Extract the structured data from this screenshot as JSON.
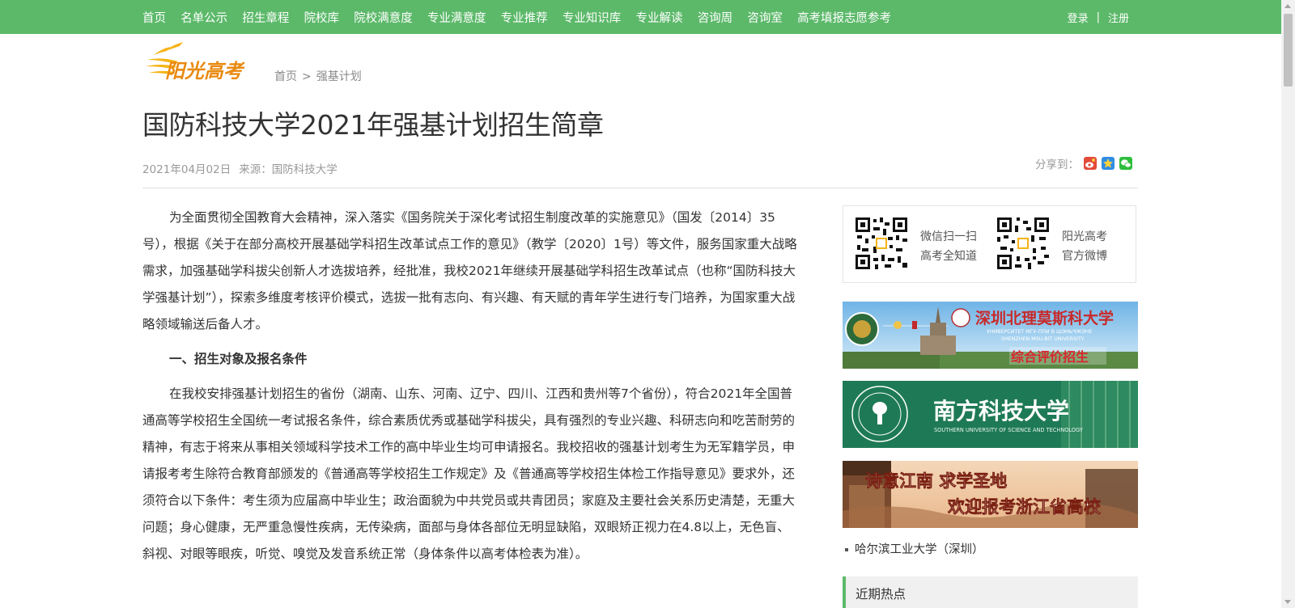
{
  "nav": {
    "items": [
      "首页",
      "名单公示",
      "招生章程",
      "院校库",
      "院校满意度",
      "专业满意度",
      "专业推荐",
      "专业知识库",
      "专业解读",
      "咨询周",
      "咨询室",
      "高考填报志愿参考"
    ],
    "login": "登录",
    "separator": "|",
    "register": "注册"
  },
  "logo": {
    "text": "阳光高考"
  },
  "breadcrumb": {
    "home": "首页",
    "sep": ">",
    "current": "强基计划"
  },
  "article": {
    "title": "国防科技大学2021年强基计划招生简章",
    "date": "2021年04月02日",
    "source": "来源：国防科技大学",
    "share_label": "分享到：",
    "paragraphs": [
      "为全面贯彻全国教育大会精神，深入落实《国务院关于深化考试招生制度改革的实施意见》（国发〔2014〕35号），根据《关于在部分高校开展基础学科招生改革试点工作的意见》（教学〔2020〕1号）等文件，服务国家重大战略需求，加强基础学科拔尖创新人才选拔培养，经批准，我校2021年继续开展基础学科招生改革试点（也称“国防科技大学强基计划”），探索多维度考核评价模式，选拔一批有志向、有兴趣、有天赋的青年学生进行专门培养，为国家重大战略领域输送后备人才。"
    ],
    "section1_heading": "一、招生对象及报名条件",
    "section1_paragraph": "在我校安排强基计划招生的省份（湖南、山东、河南、辽宁、四川、江西和贵州等7个省份），符合2021年全国普通高等学校招生全国统一考试报名条件，综合素质优秀或基础学科拔尖，具有强烈的专业兴趣、科研志向和吃苦耐劳的精神，有志于将来从事相关领域科学技术工作的高中毕业生均可申请报名。我校招收的强基计划考生为无军籍学员，申请报考考生除符合教育部颁发的《普通高等学校招生工作规定》及《普通高等学校招生体检工作指导意见》要求外，还须符合以下条件：考生须为应届高中毕业生；政治面貌为中共党员或共青团员；家庭及主要社会关系历史清楚，无重大问题；身心健康，无严重急慢性疾病，无传染病，面部与身体各部位无明显缺陷，双眼矫正视力在4.8以上，无色盲、斜视、对眼等眼疾，听觉、嗅觉及发音系统正常（身体条件以高考体检表为准）。"
  },
  "sidebar": {
    "qr1_line1": "微信扫一扫",
    "qr1_line2": "高考全知道",
    "qr2_line1": "阳光高考",
    "qr2_line2": "官方微博",
    "banner1_title": "深圳北理莫斯科大学",
    "banner1_sub1": "УНИВЕРСИТЕТ МГУ-ППИ В ШЭНЬЧЖЭНЕ",
    "banner1_sub2": "SHENZHEN MSU-BIT UNIVERSITY",
    "banner1_tag": "综合评价招生",
    "banner2_title": "南方科技大学",
    "banner2_sub": "SOUTHERN UNIVERSITY OF SCIENCE AND TECHNOLOGY",
    "banner3_line1": "诗意江南  求学圣地",
    "banner3_line2": "欢迎报考浙江省高校",
    "link1": "哈尔滨工业大学（深圳）",
    "hot_title": "近期热点"
  },
  "colors": {
    "nav_green": "#5cb96a",
    "text": "#333333",
    "muted": "#999999"
  }
}
